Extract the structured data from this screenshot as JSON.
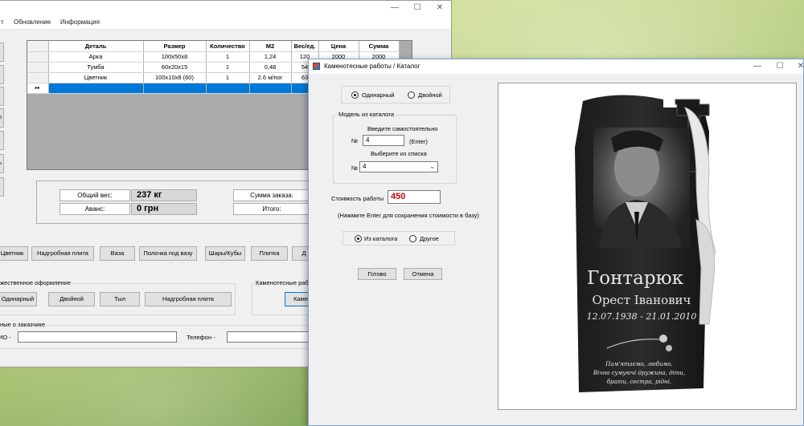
{
  "main_window": {
    "menu": [
      "т",
      "Обновление",
      "Информация"
    ],
    "grid": {
      "columns": [
        "Деталь",
        "Размер",
        "Количество",
        "М2",
        "Вес/ед.",
        "Цена",
        "Сумма"
      ],
      "rows": [
        [
          "Арка",
          "100x50x8",
          "1",
          "1,24",
          "120",
          "2000",
          "2000"
        ],
        [
          "Тумба",
          "60x20x15",
          "1",
          "0,48",
          "54",
          "",
          ""
        ],
        [
          "Цветник",
          "100x10x8 (60)",
          "1",
          "2.6 м/пог",
          "63",
          "",
          ""
        ]
      ],
      "new_row_marker": "▸▸"
    },
    "summary": {
      "weight_label": "Общий вес:",
      "weight_value": "237 кг",
      "advance_label": "Аванс:",
      "advance_value": "0 грн",
      "order_sum_label": "Сумма заказа:",
      "total_label": "Итого:"
    },
    "buttons_row": [
      "Цветник",
      "Надгробная плита",
      "Ваза",
      "Полочка под вазу",
      "Шары/Кубы",
      "Плитка",
      "Д"
    ],
    "art_group": {
      "label": "жественное оформление",
      "buttons": [
        "Одинарный",
        "Двойной",
        "Тыл",
        "Надгробная плита"
      ]
    },
    "stone_group": {
      "label": "Каменотесные рабо",
      "button": "Каме"
    },
    "customer_group": {
      "label": "ные о заказчике",
      "fio_label": "ИО -",
      "phone_label": "Телефон -"
    }
  },
  "dialog": {
    "title": "Каменотесные работы / Каталог",
    "type_options": [
      "Одинарный",
      "Двойной"
    ],
    "model_group": {
      "label": "Модель из каталога",
      "enter_hint": "Введите самостоятельно",
      "number_label": "№",
      "number_value": "4",
      "enter_label": "(Enter)",
      "choose_hint": "Выберите из списка",
      "choose_value": "4"
    },
    "cost_label": "Стоимость работы",
    "cost_value": "450",
    "save_hint": "(Нажмите Enter для сохранения стоимости в базу)",
    "source_options": [
      "Из каталога",
      "Другое"
    ],
    "ok_button": "Готово",
    "cancel_button": "Отмена",
    "monument": {
      "surname": "Гонтарюк",
      "name": "Орест Іванович",
      "dates": "12.07.1938 - 21.01.2010",
      "epitaph": [
        "Пам'ятаємо, любимо,",
        "Вічно сумуючі дружина, діти,",
        "брати, сестра, рідні."
      ]
    },
    "colors": {
      "cost_value": "#cc0000",
      "selection": "#0078d7"
    }
  }
}
